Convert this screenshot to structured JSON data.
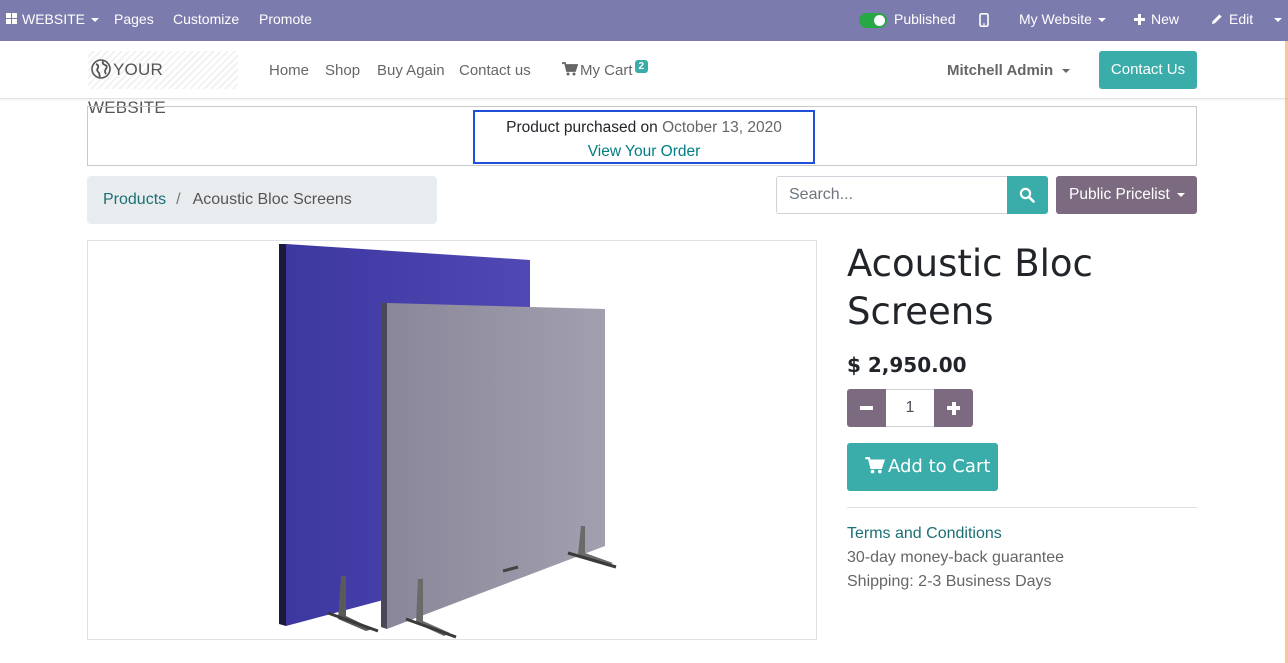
{
  "admin_bar": {
    "app_menu": "WEBSITE",
    "pages": "Pages",
    "customize": "Customize",
    "promote": "Promote",
    "published": "Published",
    "my_website": "My Website",
    "new": "New",
    "edit": "Edit",
    "colors": {
      "background": "#7c7bad",
      "toggle_on": "#28a745"
    }
  },
  "header": {
    "logo_text": "YOUR WEBSITE",
    "nav": [
      "Home",
      "Shop",
      "Buy Again",
      "Contact us"
    ],
    "cart_label": "My Cart",
    "cart_count": "2",
    "user": "Mitchell Admin",
    "contact_button": "Contact Us"
  },
  "banner": {
    "purchased_text": "Product purchased on",
    "purchased_date": "October 13, 2020",
    "view_order": "View Your Order"
  },
  "breadcrumb": {
    "parent": "Products",
    "separator": "/",
    "current": "Acoustic Bloc Screens"
  },
  "search": {
    "placeholder": "Search..."
  },
  "pricelist": {
    "label": "Public Pricelist"
  },
  "product": {
    "title": "Acoustic Bloc Screens",
    "price": "$ 2,950.00",
    "quantity": "1",
    "add_to_cart": "Add to Cart",
    "terms": "Terms and Conditions",
    "guarantee": "30-day money-back guarantee",
    "shipping": "Shipping: 2-3 Business Days",
    "image_panel_colors": {
      "blue": "#4a43a6",
      "grey": "#8f8c9e"
    }
  },
  "colors": {
    "accent": "#3aadaa",
    "secondary": "#7c6b80",
    "link": "#1c6f74",
    "highlight_border": "#1f4fd6"
  }
}
